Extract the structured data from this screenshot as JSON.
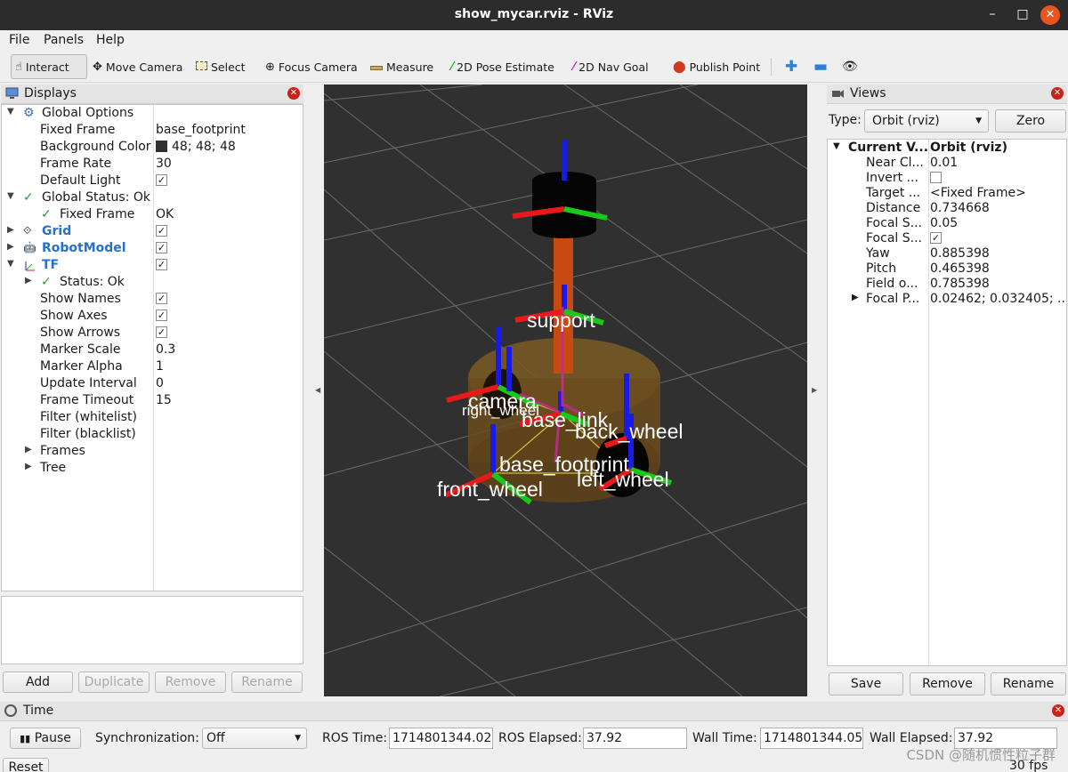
{
  "window": {
    "title": "show_mycar.rviz - RViz",
    "minimize": "–",
    "maximize": "□",
    "close": "✕"
  },
  "menu": {
    "file": "File",
    "panels": "Panels",
    "help": "Help"
  },
  "toolbar": {
    "interact": "Interact",
    "move_camera": "Move Camera",
    "select": "Select",
    "focus_camera": "Focus Camera",
    "measure": "Measure",
    "pose_estimate": "2D Pose Estimate",
    "nav_goal": "2D Nav Goal",
    "publish_point": "Publish Point",
    "icons": [
      "hand-icon",
      "move-camera-icon",
      "select-icon",
      "focus-icon",
      "ruler-icon",
      "green-arrow-icon",
      "magenta-arrow-icon",
      "map-pin-icon",
      "plus-icon",
      "minus-icon",
      "eye-icon"
    ]
  },
  "displays": {
    "title": "Displays",
    "global_options": "Global Options",
    "fixed_frame_label": "Fixed Frame",
    "fixed_frame_value": "base_footprint",
    "bg_color_label": "Background Color",
    "bg_color_value": "48; 48; 48",
    "bg_color_hex": "#303030",
    "frame_rate_label": "Frame Rate",
    "frame_rate_value": "30",
    "default_light_label": "Default Light",
    "global_status": "Global Status: Ok",
    "gs_fixed_frame_label": "Fixed Frame",
    "gs_fixed_frame_value": "OK",
    "grid": "Grid",
    "robot_model": "RobotModel",
    "tf": "TF",
    "tf_status": "Status: Ok",
    "show_names": "Show Names",
    "show_axes": "Show Axes",
    "show_arrows": "Show Arrows",
    "marker_scale_label": "Marker Scale",
    "marker_scale_value": "0.3",
    "marker_alpha_label": "Marker Alpha",
    "marker_alpha_value": "1",
    "update_interval_label": "Update Interval",
    "update_interval_value": "0",
    "frame_timeout_label": "Frame Timeout",
    "frame_timeout_value": "15",
    "filter_white": "Filter (whitelist)",
    "filter_black": "Filter (blacklist)",
    "frames": "Frames",
    "tree": "Tree",
    "checkmark": "✓",
    "buttons": {
      "add": "Add",
      "duplicate": "Duplicate",
      "remove": "Remove",
      "rename": "Rename"
    }
  },
  "viewport": {
    "frame_labels": [
      "support",
      "camera",
      "right_wheel",
      "base_link",
      "back_wheel",
      "base_footprint",
      "left_wheel",
      "front_wheel"
    ]
  },
  "views": {
    "title": "Views",
    "type_label": "Type:",
    "type_value": "Orbit (rviz)",
    "zero": "Zero",
    "current_view_label": "Current V...",
    "current_view_value": "Orbit (rviz)",
    "props": [
      {
        "k": "Near Cl...",
        "v": "0.01"
      },
      {
        "k": "Invert ...",
        "v": ""
      },
      {
        "k": "Target ...",
        "v": "<Fixed Frame>"
      },
      {
        "k": "Distance",
        "v": "0.734668"
      },
      {
        "k": "Focal S...",
        "v": "0.05"
      },
      {
        "k": "Focal S...",
        "v": ""
      },
      {
        "k": "Yaw",
        "v": "0.885398"
      },
      {
        "k": "Pitch",
        "v": "0.465398"
      },
      {
        "k": "Field o...",
        "v": "0.785398"
      },
      {
        "k": "Focal P...",
        "v": "0.02462; 0.032405; ..."
      }
    ],
    "buttons": {
      "save": "Save",
      "remove": "Remove",
      "rename": "Rename"
    }
  },
  "time": {
    "title": "Time",
    "pause": "Pause",
    "sync_label": "Synchronization:",
    "sync_value": "Off",
    "ros_time_label": "ROS Time:",
    "ros_time": "1714801344.02",
    "ros_elapsed_label": "ROS Elapsed:",
    "ros_elapsed": "37.92",
    "wall_time_label": "Wall Time:",
    "wall_time": "1714801344.05",
    "wall_elapsed_label": "Wall Elapsed:",
    "wall_elapsed": "37.92",
    "reset": "Reset",
    "fps": "30 fps"
  },
  "watermark": "CSDN @随机惯性粒子群"
}
